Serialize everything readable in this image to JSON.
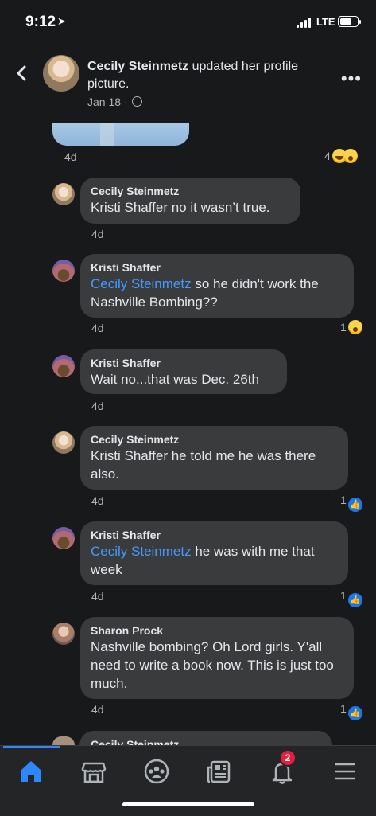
{
  "status": {
    "time": "9:12",
    "network": "LTE"
  },
  "header": {
    "author": "Cecily Steinmetz",
    "action": " updated her profile picture.",
    "date": "Jan 18 ·"
  },
  "preview_row": {
    "time": "4d",
    "reaction_count": "4"
  },
  "comments": [
    {
      "name": "Cecily Steinmetz",
      "mention": "",
      "text": "Kristi Shaffer no it wasn’t true.",
      "time": "4d",
      "reactions": ""
    },
    {
      "name": "Kristi Shaffer",
      "mention": "Cecily Steinmetz",
      "text": " so he didn't work the Nashville Bombing??",
      "time": "4d",
      "reactions": "1"
    },
    {
      "name": "Kristi Shaffer",
      "mention": "",
      "text": "Wait no...that was Dec. 26th",
      "time": "4d",
      "reactions": ""
    },
    {
      "name": "Cecily Steinmetz",
      "mention": "",
      "text": "Kristi Shaffer he told me he was there also.",
      "time": "4d",
      "reactions": "1"
    },
    {
      "name": "Kristi Shaffer",
      "mention": "Cecily Steinmetz",
      "text": " he was with me that week",
      "time": "4d",
      "reactions": "1"
    },
    {
      "name": "Sharon Prock",
      "mention": "",
      "text": "Nashville bombing? Oh Lord girls. Y'all need to write a book now. This is just too much.",
      "time": "4d",
      "reactions": "1"
    }
  ],
  "cutoff_comment": {
    "name": "Cecily Steinmetz"
  },
  "nav": {
    "items": [
      "home-icon",
      "marketplace-icon",
      "groups-icon",
      "news-feed-icon",
      "notifications-icon",
      "menu-icon"
    ],
    "notification_badge": "2",
    "accent": "#2d88ff"
  }
}
